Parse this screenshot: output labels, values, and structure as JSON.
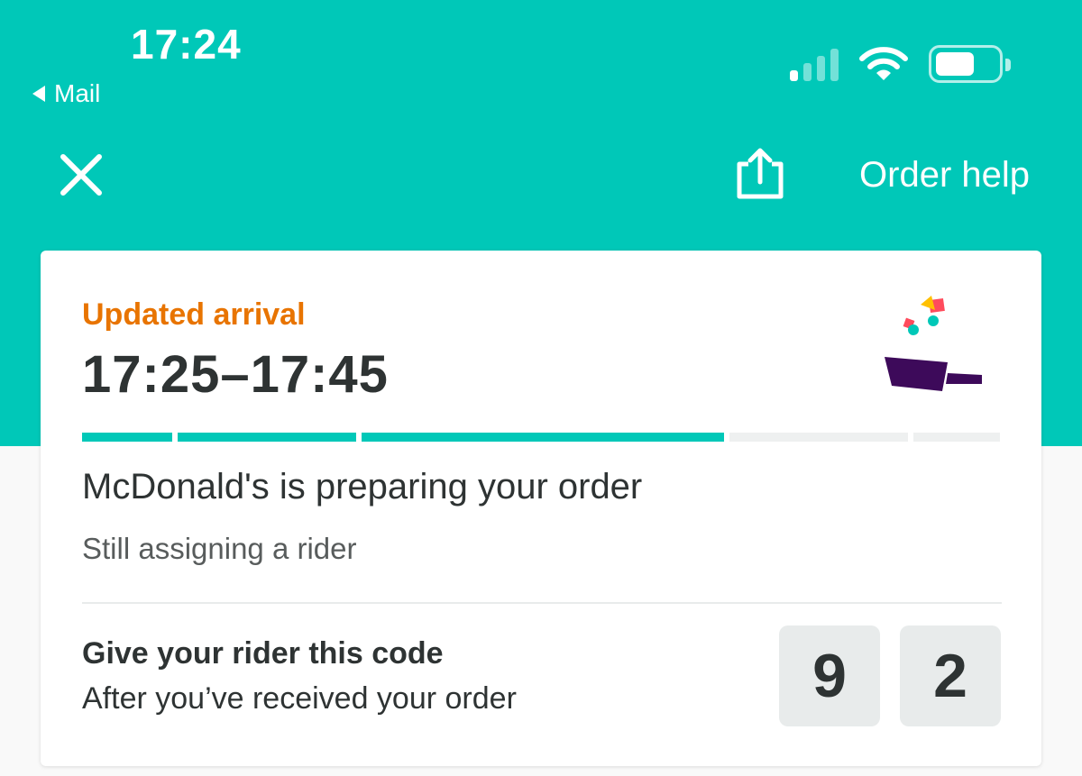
{
  "status_bar": {
    "time": "17:24",
    "back_label": "Mail"
  },
  "header": {
    "order_help": "Order help",
    "close_icon": "close-icon",
    "share_icon": "share-icon"
  },
  "card": {
    "arrival_label": "Updated arrival",
    "arrival_time": "17:25–17:45",
    "progress": {
      "segments_total": 5,
      "segments_complete": 3,
      "complete_color": "#00c8b8",
      "incomplete_color": "#eef0f0"
    },
    "status_main": "McDonald's is preparing your order",
    "status_sub": "Still assigning a rider",
    "code_title": "Give your rider this code",
    "code_sub": "After you’ve received your order",
    "code_digits": [
      "9",
      "2"
    ]
  },
  "colors": {
    "brand_teal": "#00c8b8",
    "accent_orange": "#e87400",
    "text_dark": "#2e3333"
  }
}
